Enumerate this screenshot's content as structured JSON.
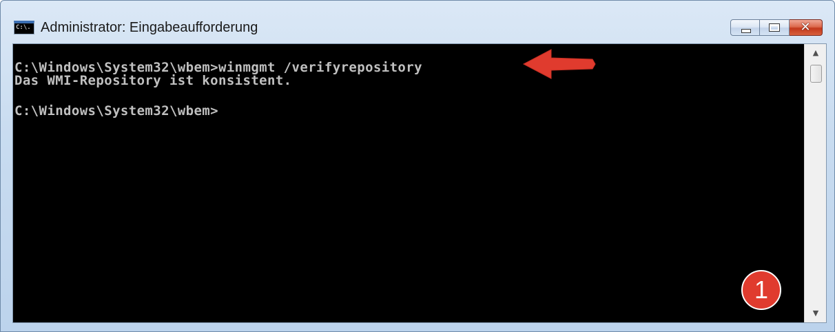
{
  "window": {
    "title": "Administrator: Eingabeaufforderung",
    "icon_text": "C:\\."
  },
  "controls": {
    "minimize_icon": "minimize-icon",
    "maximize_icon": "maximize-icon",
    "close_icon": "close-icon",
    "close_glyph": "✕"
  },
  "console": {
    "lines": [
      "C:\\Windows\\System32\\wbem>winmgmt /verifyrepository",
      "Das WMI-Repository ist konsistent.",
      "",
      "C:\\Windows\\System32\\wbem>"
    ],
    "text_color": "#c0c0c0",
    "background_color": "#000000"
  },
  "scrollbar": {
    "up_arrow": "▲",
    "down_arrow": "▼"
  },
  "annotations": {
    "arrow_color": "#e03b2e",
    "badge_label": "1"
  }
}
